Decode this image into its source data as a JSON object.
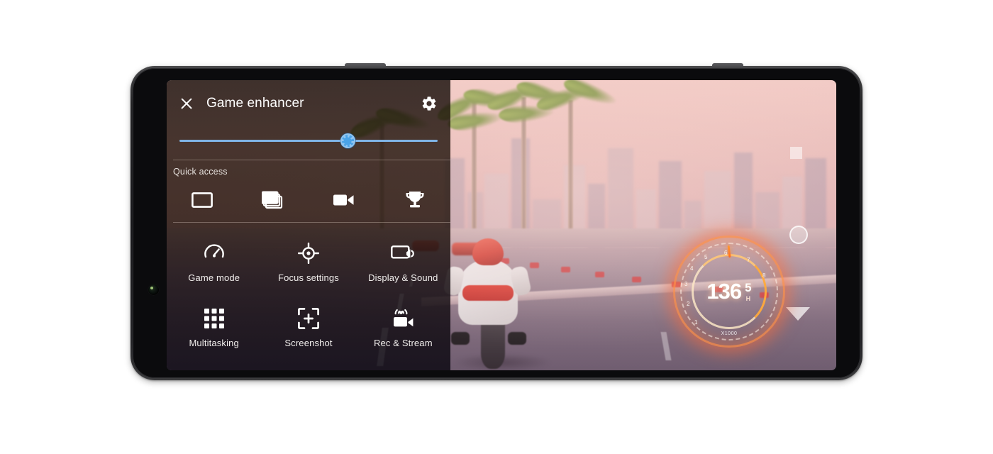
{
  "panel": {
    "title": "Game enhancer",
    "close_icon": "close-icon",
    "settings_icon": "gear-icon",
    "brightness": {
      "label": "brightness-slider",
      "value_percent": 65,
      "track_color": "#7fb4e6",
      "thumb_icon": "brightness-sun-icon"
    },
    "quick_access": {
      "label": "Quick access",
      "items": [
        {
          "name": "window-mode",
          "icon": "window-outline-icon"
        },
        {
          "name": "multi-window",
          "icon": "window-stack-icon"
        },
        {
          "name": "record",
          "icon": "video-camera-icon"
        },
        {
          "name": "achievements",
          "icon": "trophy-icon"
        }
      ]
    },
    "menu": [
      {
        "label": "Game mode",
        "icon": "speedometer-icon"
      },
      {
        "label": "Focus settings",
        "icon": "crosshair-icon"
      },
      {
        "label": "Display & Sound",
        "icon": "screen-speaker-icon"
      },
      {
        "label": "Multitasking",
        "icon": "grid-dots-icon"
      },
      {
        "label": "Screenshot",
        "icon": "crop-plus-icon"
      },
      {
        "label": "Rec & Stream",
        "icon": "broadcast-camera-icon"
      }
    ]
  },
  "game_hud": {
    "speed_value": "136",
    "gear_value": "5",
    "gear_unit": "H",
    "rpm_label": "X1000",
    "rpm_ticks": [
      "1",
      "2",
      "3",
      "4",
      "5",
      "6",
      "7",
      "8"
    ],
    "accent_color": "#ff8c46",
    "controls": [
      {
        "name": "round-button",
        "icon": "circle-button-icon"
      },
      {
        "name": "down-button",
        "icon": "triangle-down-icon"
      },
      {
        "name": "square-marker",
        "icon": "square-icon"
      }
    ]
  },
  "device": {
    "name": "smartphone-landscape",
    "camera_icon": "front-camera-icon"
  }
}
